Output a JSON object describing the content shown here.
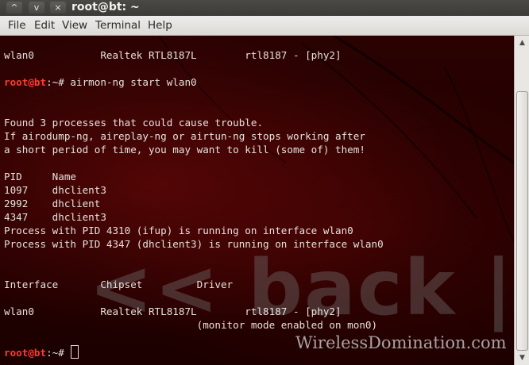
{
  "window": {
    "title": "root@bt: ~",
    "buttons": [
      {
        "name": "minimize",
        "glyph": "^"
      },
      {
        "name": "maximize",
        "glyph": "v"
      },
      {
        "name": "close",
        "glyph": "×"
      }
    ]
  },
  "menubar": {
    "items": [
      "File",
      "Edit",
      "View",
      "Terminal",
      "Help"
    ]
  },
  "terminal": {
    "background_brand": "<< back | tra",
    "watermark": "WirelessDomination.com",
    "prompt_user": "root@bt",
    "prompt_rest": ":~#",
    "lines": [
      {
        "text": "wlan0           Realtek RTL8187L        rtl8187 - [phy2]"
      },
      {
        "text": ""
      },
      {
        "prompt": true,
        "text": " airmon-ng start wlan0"
      },
      {
        "text": ""
      },
      {
        "text": ""
      },
      {
        "text": "Found 3 processes that could cause trouble."
      },
      {
        "text": "If airodump-ng, aireplay-ng or airtun-ng stops working after"
      },
      {
        "text": "a short period of time, you may want to kill (some of) them!"
      },
      {
        "text": ""
      },
      {
        "text": "PID     Name"
      },
      {
        "text": "1097    dhclient3"
      },
      {
        "text": "2992    dhclient"
      },
      {
        "text": "4347    dhclient3"
      },
      {
        "text": "Process with PID 4310 (ifup) is running on interface wlan0"
      },
      {
        "text": "Process with PID 4347 (dhclient3) is running on interface wlan0"
      },
      {
        "text": ""
      },
      {
        "text": ""
      },
      {
        "text": "Interface       Chipset         Driver"
      },
      {
        "text": ""
      },
      {
        "text": "wlan0           Realtek RTL8187L        rtl8187 - [phy2]"
      },
      {
        "text": "                                (monitor mode enabled on mon0)"
      },
      {
        "text": ""
      },
      {
        "prompt": true,
        "text": " ",
        "cursor": true
      }
    ]
  },
  "colors": {
    "prompt_user": "#ff3b2f",
    "terminal_text": "#e6e2dd",
    "terminal_bg": "#220000"
  }
}
